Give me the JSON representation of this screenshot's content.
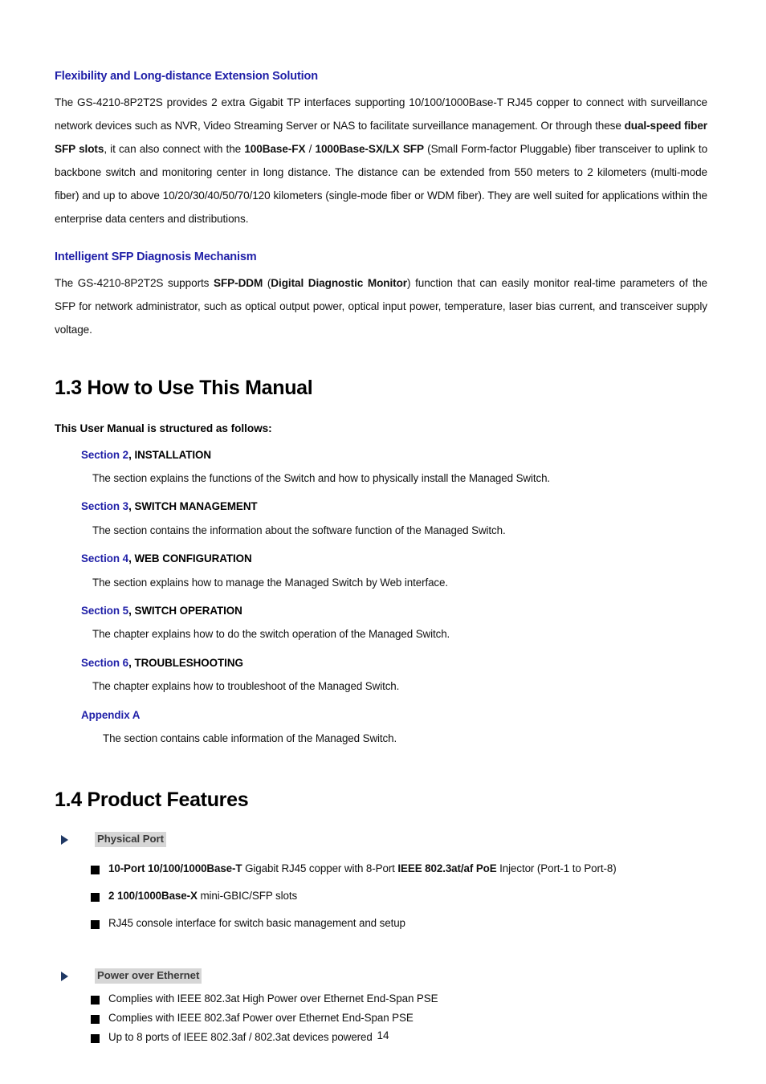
{
  "document": {
    "page_number": "14",
    "accent_blue": "#2020a8",
    "bullet_navy": "#1f3864",
    "highlight_gray": "#d6d6d6"
  },
  "sections": {
    "flexibility": {
      "heading": "Flexibility and Long-distance Extension Solution",
      "paragraph_parts": [
        {
          "text": "The GS-4210-8P2T2S provides 2 extra Gigabit TP interfaces supporting 10/100/1000Base-T RJ45 copper to connect with surveillance network devices such as NVR, Video Streaming Server or NAS to facilitate surveillance management. Or through these ",
          "bold": false
        },
        {
          "text": "dual-speed fiber SFP slots",
          "bold": true
        },
        {
          "text": ", it can also connect with the ",
          "bold": false
        },
        {
          "text": "100Base-FX",
          "bold": true
        },
        {
          "text": " / ",
          "bold": false
        },
        {
          "text": "1000Base-SX/LX SFP",
          "bold": true
        },
        {
          "text": " (Small Form-factor Pluggable) fiber transceiver to uplink to backbone switch and monitoring center in long distance. The distance can be extended from 550 meters to 2 kilometers (multi-mode fiber) and up to above 10/20/30/40/50/70/120 kilometers (single-mode fiber or WDM fiber). They are well suited for applications within the enterprise data centers and distributions.",
          "bold": false
        }
      ]
    },
    "sfp_diagnosis": {
      "heading": "Intelligent SFP Diagnosis Mechanism",
      "paragraph_parts": [
        {
          "text": "The GS-4210-8P2T2S supports ",
          "bold": false
        },
        {
          "text": "SFP-DDM",
          "bold": true
        },
        {
          "text": " (",
          "bold": false
        },
        {
          "text": "Digital Diagnostic Monitor",
          "bold": true
        },
        {
          "text": ") function that can easily monitor real-time parameters of the SFP for network administrator, such as optical output power, optical input power, temperature, laser bias current, and transceiver supply voltage.",
          "bold": false
        }
      ]
    }
  },
  "how_to_use": {
    "title": "1.3 How to Use This Manual",
    "intro": "This User Manual is structured as follows:",
    "entries": [
      {
        "number": "Section 2",
        "separator": ", ",
        "name": "INSTALLATION",
        "description": "The section explains the functions of the Switch and how to physically install the Managed Switch.",
        "deep_indent": false
      },
      {
        "number": "Section 3",
        "separator": ", ",
        "name": "SWITCH MANAGEMENT",
        "description": "The section contains the information about the software function of the Managed Switch.",
        "deep_indent": false
      },
      {
        "number": "Section 4",
        "separator": ", ",
        "name": "WEB CONFIGURATION",
        "description": "The section explains how to manage the Managed Switch by Web interface.",
        "deep_indent": false
      },
      {
        "number": "Section 5",
        "separator": ", ",
        "name": "SWITCH OPERATION",
        "description": "The chapter explains how to do the switch operation of the Managed Switch.",
        "deep_indent": false
      },
      {
        "number": "Section 6",
        "separator": ", ",
        "name": "TROUBLESHOOTING",
        "description": "The chapter explains how to troubleshoot of the Managed Switch.",
        "deep_indent": false
      },
      {
        "number": "Appendix A",
        "separator": "",
        "name": "",
        "description": "The section contains cable information of the Managed Switch.",
        "deep_indent": true
      }
    ]
  },
  "product_features": {
    "title": "1.4 Product Features",
    "groups": [
      {
        "label": "Physical Port",
        "spacing": "wide",
        "items": [
          [
            {
              "text": "10-Port 10/100/1000Base-T",
              "bold": true
            },
            {
              "text": " Gigabit RJ45 copper with 8-Port ",
              "bold": false
            },
            {
              "text": "IEEE 802.3at/af PoE",
              "bold": true
            },
            {
              "text": " Injector (Port-1 to Port-8)",
              "bold": false
            }
          ],
          [
            {
              "text": "2 100/1000Base-X",
              "bold": true
            },
            {
              "text": " mini-GBIC/SFP slots",
              "bold": false
            }
          ],
          [
            {
              "text": "RJ45 console interface for switch basic management and setup",
              "bold": false
            }
          ]
        ]
      },
      {
        "label": "Power over Ethernet",
        "spacing": "tight",
        "items": [
          [
            {
              "text": "Complies with IEEE 802.3at High Power over Ethernet End-Span PSE",
              "bold": false
            }
          ],
          [
            {
              "text": "Complies with IEEE 802.3af Power over Ethernet End-Span PSE",
              "bold": false
            }
          ],
          [
            {
              "text": "Up to 8 ports of IEEE 802.3af / 802.3at devices powered",
              "bold": false
            }
          ]
        ]
      }
    ]
  }
}
